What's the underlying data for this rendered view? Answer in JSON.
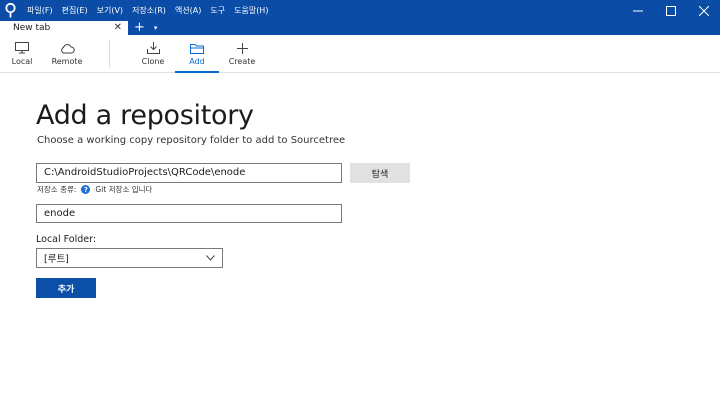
{
  "menu": {
    "items": [
      "파일(F)",
      "편집(E)",
      "보기(V)",
      "저장소(R)",
      "액션(A)",
      "도구",
      "도움말(H)"
    ]
  },
  "window": {
    "minimize": "—",
    "maximize": "☐",
    "close": "✕"
  },
  "tabs": {
    "active_label": "New tab",
    "close_glyph": "✕",
    "add_glyph": "+",
    "menu_glyph": "▾"
  },
  "toolbar": {
    "local": "Local",
    "remote": "Remote",
    "clone": "Clone",
    "add": "Add",
    "create": "Create",
    "active": "add"
  },
  "main": {
    "title": "Add a repository",
    "subtitle": "Choose a working copy repository folder to add to Sourcetree",
    "path_value": "C:\\AndroidStudioProjects\\QRCode\\enode",
    "browse_label": "탐색",
    "repo_type_label": "저장소 종류:",
    "repo_type_value": "Git 저장소 입니다",
    "name_value": "enode",
    "local_folder_label": "Local Folder:",
    "local_folder_value": "[루트]",
    "add_button_label": "추가"
  },
  "colors": {
    "titlebar": "#0a4ca6",
    "accent": "#0a6cce",
    "primary_button": "#0b4fa8"
  }
}
